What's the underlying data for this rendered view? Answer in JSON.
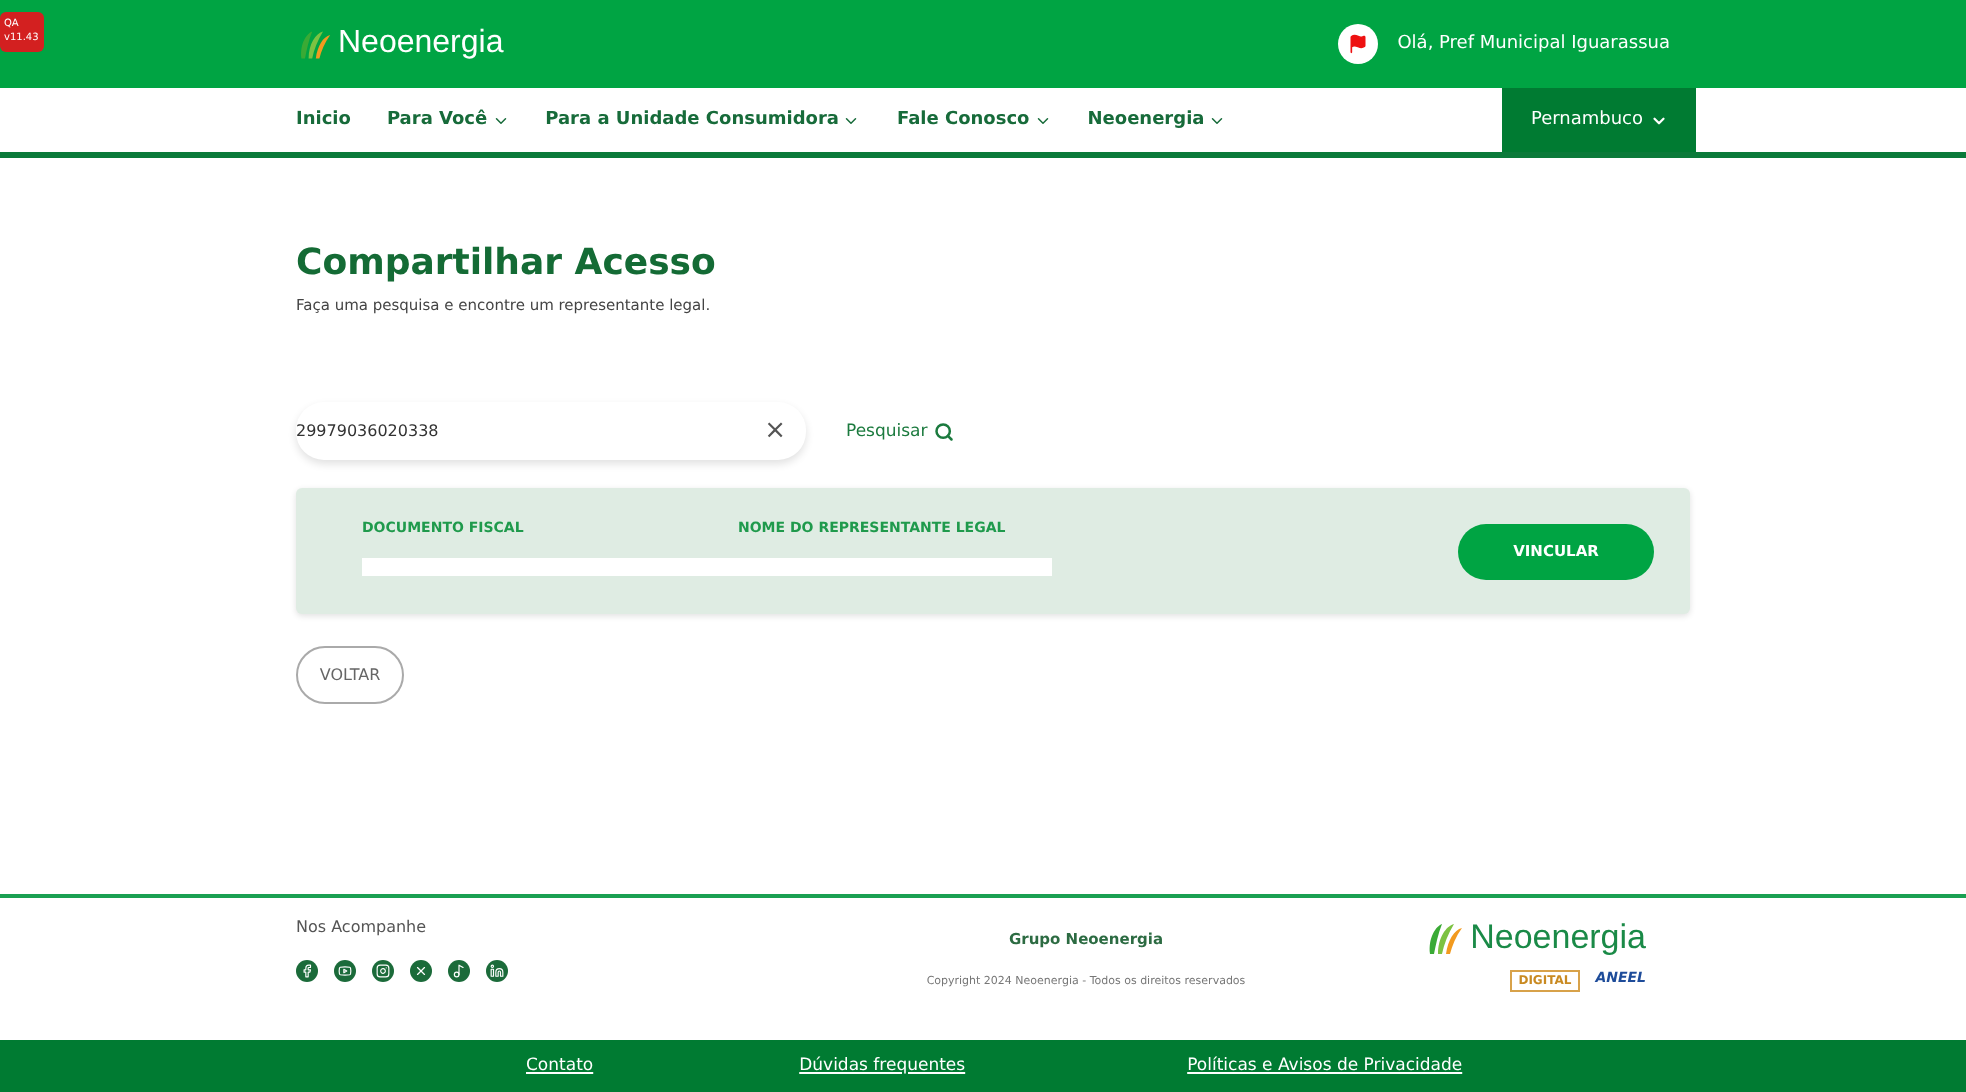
{
  "env_badge": {
    "lines": [
      "QA",
      "v11.43"
    ]
  },
  "header": {
    "logo": "Neoenergia",
    "greeting": "Olá, Pref Municipal Iguarassua"
  },
  "nav": {
    "items": [
      {
        "label": "Inicio",
        "dropdown": false
      },
      {
        "label": "Para Você",
        "dropdown": true
      },
      {
        "label": "Para a Unidade Consumidora",
        "dropdown": true
      },
      {
        "label": "Fale Conosco",
        "dropdown": true
      },
      {
        "label": "Neoenergia",
        "dropdown": true
      }
    ],
    "region": "Pernambuco"
  },
  "page": {
    "title": "Compartilhar Acesso",
    "subtitle": "Faça uma pesquisa e encontre um representante legal."
  },
  "search": {
    "value": "29979036020338",
    "clear": "×",
    "button": "Pesquisar"
  },
  "result": {
    "columns": [
      "DOCUMENTO FISCAL",
      "NOME DO REPRESENTANTE LEGAL"
    ],
    "action": "VINCULAR"
  },
  "back_button": "VOLTAR",
  "footer": {
    "follow": "Nos Acompanhe",
    "socials": [
      {
        "kind": "facebook"
      },
      {
        "kind": "youtube"
      },
      {
        "kind": "instagram"
      },
      {
        "kind": "x"
      },
      {
        "kind": "tiktok"
      },
      {
        "kind": "linkedin"
      }
    ],
    "group": "Grupo Neoenergia",
    "copyright": "Copyright 2024 Neoenergia - Todos os direitos reservados",
    "logo": "Neoenergia",
    "badges": [
      "DIGITAL",
      "ANEEL"
    ],
    "links": [
      "Contato",
      "Dúvidas frequentes",
      "Políticas e Avisos de Privacidade"
    ]
  }
}
